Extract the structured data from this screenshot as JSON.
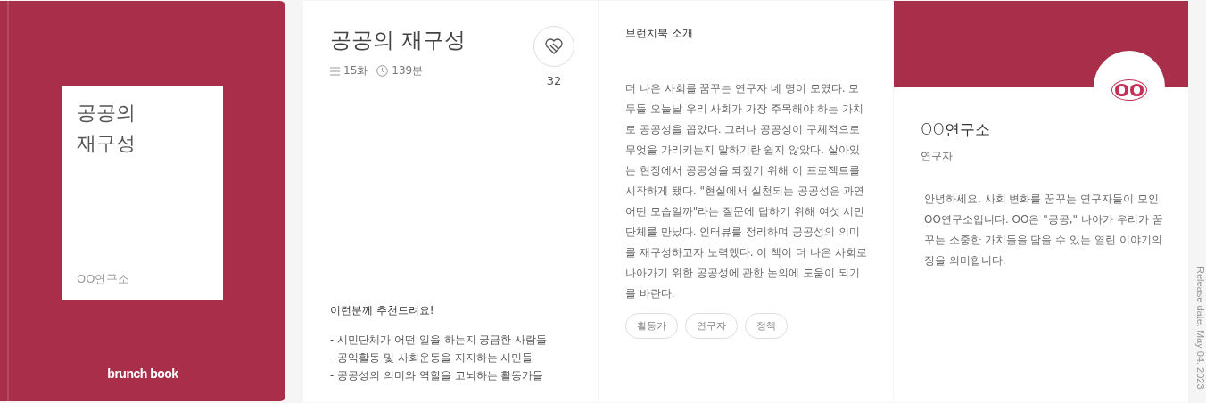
{
  "cover": {
    "title_lines": [
      "공공의",
      "재구성"
    ],
    "author": "OO연구소",
    "brand": "brunch book"
  },
  "book": {
    "title": "공공의 재구성",
    "episodes": "15화",
    "duration": "139분",
    "likes": "32",
    "recommend_title": "이런분께 추천드려요!",
    "recommend": [
      "- 시민단체가 어떤 일을 하는지 궁금한 사람들",
      "- 공익활동 및 사회운동을 지지하는 시민들",
      "- 공공성의 의미와 역할을 고뇌하는 활동가들"
    ]
  },
  "intro": {
    "heading": "브런치북 소개",
    "body": "더 나은 사회를 꿈꾸는 연구자 네 명이 모였다. 모두들 오늘날 우리 사회가 가장 주목해야 하는 가치로 공공성을 꼽았다. 그러나 공공성이 구체적으로 무엇을 가리키는지 말하기란 쉽지 않았다. 살아있는 현장에서 공공성을 되짚기 위해 이 프로젝트를 시작하게 됐다. \"현실에서 실천되는 공공성은 과연 어떤 모습일까\"라는 질문에 답하기 위해 여섯 시민단체를 만났다. 인터뷰를 정리하며 공공성의 의미를 재구성하고자 노력했다. 이 책이 더 나은 사회로 나아가기 위한 공공성에 관한 논의에 도움이 되기를 바란다.",
    "tags": [
      "활동가",
      "연구자",
      "정책"
    ]
  },
  "author": {
    "logo_text": "OO",
    "name": "OO연구소",
    "role": "연구자",
    "bio": "안녕하세요. 사회 변화를 꿈꾸는 연구자들이 모인 OO연구소입니다. OO은 \"공공,\" 나아가 우리가 꿈꾸는 소중한 가치들을 담을 수 있는 열린 이야기의 장을 의미합니다."
  },
  "release_date": "Release date. May 04. 2023"
}
